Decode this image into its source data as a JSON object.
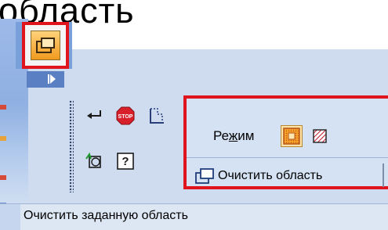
{
  "heading": {
    "text": "область"
  },
  "header_button": {
    "icon": "clear-area-icon"
  },
  "toolbar": {
    "icons": [
      "enter-arrow-icon",
      "stop-icon",
      "select-area-icon",
      "rotate-view-icon",
      "help-icon"
    ]
  },
  "mode_panel": {
    "mode_label": "Режим",
    "mode_label_prefix": "Ре",
    "mode_label_hotkey": "ж",
    "mode_label_suffix": "им",
    "clear_button_label": "Очистить область"
  },
  "status_bar": {
    "text": "Очистить заданную область"
  },
  "colors": {
    "highlight": "#e0141c",
    "panel_bg": "#cfdcf0",
    "accent_blue": "#5a7fc3",
    "icon_orange": "#f09a1e"
  }
}
